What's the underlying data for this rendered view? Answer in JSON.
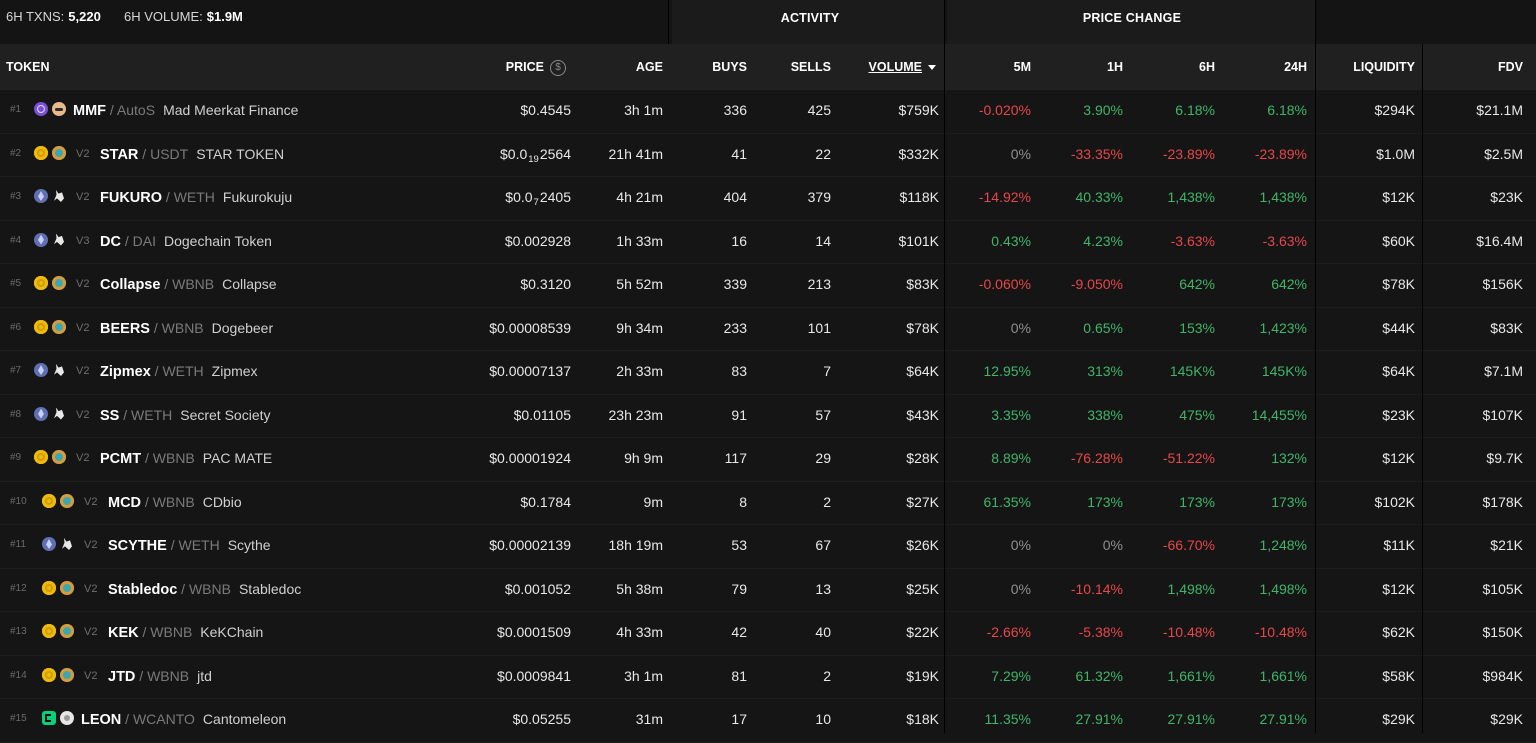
{
  "summary": {
    "txns_label": "6H TXNS:",
    "txns_value": "5,220",
    "volume_label": "6H VOLUME:",
    "volume_value": "$1.9M"
  },
  "groups": {
    "activity": "ACTIVITY",
    "price_change": "PRICE CHANGE"
  },
  "columns": {
    "token": "TOKEN",
    "price": "PRICE",
    "age": "AGE",
    "buys": "BUYS",
    "sells": "SELLS",
    "volume": "VOLUME",
    "m5": "5M",
    "h1": "1H",
    "h6": "6H",
    "h24": "24H",
    "liquidity": "LIQUIDITY",
    "fdv": "FDV"
  },
  "colors": {
    "positive": "#3fb56a",
    "negative": "#e6474a",
    "neutral": "#8f8f8f",
    "background": "#111111"
  },
  "rows": [
    {
      "rank": "#1",
      "chain_icon": "solana-icon",
      "dex_icon": "meerkat-icon",
      "version": "",
      "symbol": "MMF",
      "quote": "AutoS",
      "name": "Mad Meerkat Finance",
      "price": "$0.4545",
      "age": "3h 1m",
      "buys": "336",
      "sells": "425",
      "volume": "$759K",
      "m5": "-0.020%",
      "h1": "3.90%",
      "h6": "6.18%",
      "h24": "6.18%",
      "liquidity": "$294K",
      "fdv": "$21.1M"
    },
    {
      "rank": "#2",
      "chain_icon": "bsc-icon",
      "dex_icon": "pancakeswap-icon",
      "version": "V2",
      "symbol": "STAR",
      "quote": "USDT",
      "name": "STAR TOKEN",
      "price": "$0.0",
      "price_sub": "19",
      "price_tail": "2564",
      "age": "21h 41m",
      "buys": "41",
      "sells": "22",
      "volume": "$332K",
      "m5": "0%",
      "h1": "-33.35%",
      "h6": "-23.89%",
      "h24": "-23.89%",
      "liquidity": "$1.0M",
      "fdv": "$2.5M"
    },
    {
      "rank": "#3",
      "chain_icon": "ethereum-icon",
      "dex_icon": "uniswap-icon",
      "version": "V2",
      "symbol": "FUKURO",
      "quote": "WETH",
      "name": "Fukurokuju",
      "price": "$0.0",
      "price_sub": "7",
      "price_tail": "2405",
      "age": "4h 21m",
      "buys": "404",
      "sells": "379",
      "volume": "$118K",
      "m5": "-14.92%",
      "h1": "40.33%",
      "h6": "1,438%",
      "h24": "1,438%",
      "liquidity": "$12K",
      "fdv": "$23K"
    },
    {
      "rank": "#4",
      "chain_icon": "ethereum-icon",
      "dex_icon": "uniswap-icon",
      "version": "V3",
      "symbol": "DC",
      "quote": "DAI",
      "name": "Dogechain Token",
      "price": "$0.002928",
      "age": "1h 33m",
      "buys": "16",
      "sells": "14",
      "volume": "$101K",
      "m5": "0.43%",
      "h1": "4.23%",
      "h6": "-3.63%",
      "h24": "-3.63%",
      "liquidity": "$60K",
      "fdv": "$16.4M"
    },
    {
      "rank": "#5",
      "chain_icon": "bsc-icon",
      "dex_icon": "pancakeswap-icon",
      "version": "V2",
      "symbol": "Collapse",
      "quote": "WBNB",
      "name": "Collapse",
      "price": "$0.3120",
      "age": "5h 52m",
      "buys": "339",
      "sells": "213",
      "volume": "$83K",
      "m5": "-0.060%",
      "h1": "-9.050%",
      "h6": "642%",
      "h24": "642%",
      "liquidity": "$78K",
      "fdv": "$156K"
    },
    {
      "rank": "#6",
      "chain_icon": "bsc-icon",
      "dex_icon": "pancakeswap-icon",
      "version": "V2",
      "symbol": "BEERS",
      "quote": "WBNB",
      "name": "Dogebeer",
      "price": "$0.00008539",
      "age": "9h 34m",
      "buys": "233",
      "sells": "101",
      "volume": "$78K",
      "m5": "0%",
      "h1": "0.65%",
      "h6": "153%",
      "h24": "1,423%",
      "liquidity": "$44K",
      "fdv": "$83K"
    },
    {
      "rank": "#7",
      "chain_icon": "ethereum-icon",
      "dex_icon": "uniswap-icon",
      "version": "V2",
      "symbol": "Zipmex",
      "quote": "WETH",
      "name": "Zipmex",
      "price": "$0.00007137",
      "age": "2h 33m",
      "buys": "83",
      "sells": "7",
      "volume": "$64K",
      "m5": "12.95%",
      "h1": "313%",
      "h6": "145K%",
      "h24": "145K%",
      "liquidity": "$64K",
      "fdv": "$7.1M"
    },
    {
      "rank": "#8",
      "chain_icon": "ethereum-icon",
      "dex_icon": "uniswap-icon",
      "version": "V2",
      "symbol": "SS",
      "quote": "WETH",
      "name": "Secret Society",
      "price": "$0.01105",
      "age": "23h 23m",
      "buys": "91",
      "sells": "57",
      "volume": "$43K",
      "m5": "3.35%",
      "h1": "338%",
      "h6": "475%",
      "h24": "14,455%",
      "liquidity": "$23K",
      "fdv": "$107K"
    },
    {
      "rank": "#9",
      "chain_icon": "bsc-icon",
      "dex_icon": "pancakeswap-icon",
      "version": "V2",
      "symbol": "PCMT",
      "quote": "WBNB",
      "name": "PAC MATE",
      "price": "$0.00001924",
      "age": "9h 9m",
      "buys": "117",
      "sells": "29",
      "volume": "$28K",
      "m5": "8.89%",
      "h1": "-76.28%",
      "h6": "-51.22%",
      "h24": "132%",
      "liquidity": "$12K",
      "fdv": "$9.7K"
    },
    {
      "rank": "#10",
      "chain_icon": "bsc-icon",
      "dex_icon": "pancakeswap-icon",
      "version": "V2",
      "symbol": "MCD",
      "quote": "WBNB",
      "name": "CDbio",
      "price": "$0.1784",
      "age": "9m",
      "buys": "8",
      "sells": "2",
      "volume": "$27K",
      "m5": "61.35%",
      "h1": "173%",
      "h6": "173%",
      "h24": "173%",
      "liquidity": "$102K",
      "fdv": "$178K"
    },
    {
      "rank": "#11",
      "chain_icon": "ethereum-icon",
      "dex_icon": "uniswap-icon",
      "version": "V2",
      "symbol": "SCYTHE",
      "quote": "WETH",
      "name": "Scythe",
      "price": "$0.00002139",
      "age": "18h 19m",
      "buys": "53",
      "sells": "67",
      "volume": "$26K",
      "m5": "0%",
      "h1": "0%",
      "h6": "-66.70%",
      "h24": "1,248%",
      "liquidity": "$11K",
      "fdv": "$21K"
    },
    {
      "rank": "#12",
      "chain_icon": "bsc-icon",
      "dex_icon": "pancakeswap-icon",
      "version": "V2",
      "symbol": "Stabledoc",
      "quote": "WBNB",
      "name": "Stabledoc",
      "price": "$0.001052",
      "age": "5h 38m",
      "buys": "79",
      "sells": "13",
      "volume": "$25K",
      "m5": "0%",
      "h1": "-10.14%",
      "h6": "1,498%",
      "h24": "1,498%",
      "liquidity": "$12K",
      "fdv": "$105K"
    },
    {
      "rank": "#13",
      "chain_icon": "bsc-icon",
      "dex_icon": "pancakeswap-icon",
      "version": "V2",
      "symbol": "KEK",
      "quote": "WBNB",
      "name": "KeKChain",
      "price": "$0.0001509",
      "age": "4h 33m",
      "buys": "42",
      "sells": "40",
      "volume": "$22K",
      "m5": "-2.66%",
      "h1": "-5.38%",
      "h6": "-10.48%",
      "h24": "-10.48%",
      "liquidity": "$62K",
      "fdv": "$150K"
    },
    {
      "rank": "#14",
      "chain_icon": "bsc-icon",
      "dex_icon": "pancakeswap-icon",
      "version": "V2",
      "symbol": "JTD",
      "quote": "WBNB",
      "name": "jtd",
      "price": "$0.0009841",
      "age": "3h 1m",
      "buys": "81",
      "sells": "2",
      "volume": "$19K",
      "m5": "7.29%",
      "h1": "61.32%",
      "h6": "1,661%",
      "h24": "1,661%",
      "liquidity": "$58K",
      "fdv": "$984K"
    },
    {
      "rank": "#15",
      "chain_icon": "canto-icon",
      "dex_icon": "dex-icon",
      "version": "",
      "symbol": "LEON",
      "quote": "WCANTO",
      "name": "Cantomeleon",
      "price": "$0.05255",
      "age": "31m",
      "buys": "17",
      "sells": "10",
      "volume": "$18K",
      "m5": "11.35%",
      "h1": "27.91%",
      "h6": "27.91%",
      "h24": "27.91%",
      "liquidity": "$29K",
      "fdv": "$29K"
    }
  ]
}
